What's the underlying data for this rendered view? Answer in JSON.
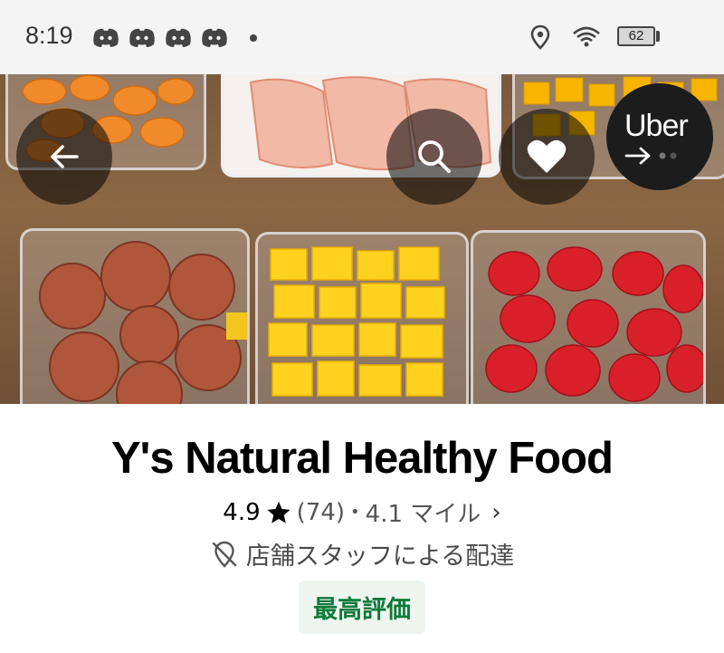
{
  "status_bar": {
    "time": "8:19",
    "notification_icons": [
      "discord-icon",
      "discord-icon",
      "discord-icon",
      "discord-icon"
    ],
    "system_icons": [
      "location-icon",
      "wifi-icon",
      "battery-icon"
    ],
    "battery_level": "62"
  },
  "header": {
    "buttons": [
      "back-arrow-icon",
      "search-icon",
      "heart-icon"
    ],
    "brand_label": "Uber"
  },
  "store": {
    "name": "Y's Natural Healthy Food",
    "rating": "4.9",
    "review_count": "(74)",
    "separator": "•",
    "distance": "4.1 マイル",
    "chevron": "›",
    "delivery_note": "店舗スタッフによる配達",
    "badge": "最高評価"
  },
  "colors": {
    "badge_text": "#0e7a3a",
    "badge_bg": "#eef5ef"
  }
}
